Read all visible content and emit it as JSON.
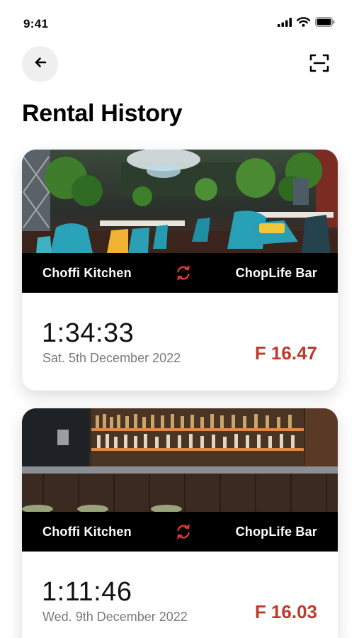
{
  "status_bar": {
    "time": "9:41",
    "icons": [
      "signal-icon",
      "wifi-icon",
      "battery-icon"
    ]
  },
  "header": {
    "back_icon": "arrow-left-icon",
    "scan_icon": "scan-icon",
    "title": "Rental History"
  },
  "colors": {
    "accent": "#c0392b",
    "route_bar": "#000000",
    "back_button_bg": "#efefef"
  },
  "rentals": [
    {
      "image": "restaurant-interior",
      "from": "Choffi Kitchen",
      "to": "ChopLife Bar",
      "route_icon": "swap-icon",
      "duration": "1:34:33",
      "date": "Sat. 5th December 2022",
      "price": "F 16.47"
    },
    {
      "image": "bar-counter",
      "from": "Choffi Kitchen",
      "to": "ChopLife Bar",
      "route_icon": "swap-icon",
      "duration": "1:11:46",
      "date": "Wed. 9th December 2022",
      "price": "F 16.03"
    }
  ]
}
